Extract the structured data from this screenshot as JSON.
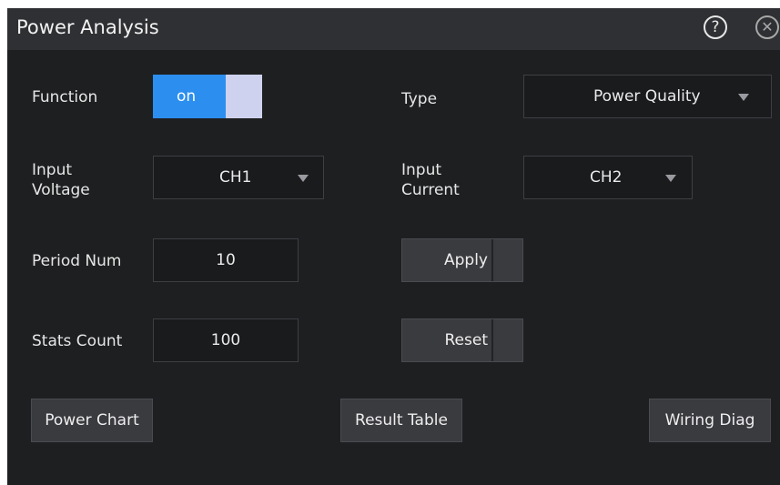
{
  "dialog": {
    "title": "Power Analysis",
    "help_icon": "help-icon",
    "close_icon": "close-icon"
  },
  "function": {
    "label": "Function",
    "toggle_state": "on"
  },
  "type": {
    "label": "Type",
    "value": "Power Quality"
  },
  "input_voltage": {
    "label": "Input Voltage",
    "value": "CH1"
  },
  "input_current": {
    "label": "Input Current",
    "value": "CH2"
  },
  "period_num": {
    "label": "Period Num",
    "value": "10"
  },
  "stats_count": {
    "label": "Stats Count",
    "value": "100"
  },
  "buttons": {
    "apply": "Apply",
    "reset": "Reset",
    "power_chart": "Power Chart",
    "result_table": "Result Table",
    "wiring_diag": "Wiring Diag"
  },
  "colors": {
    "toggle_on": "#2c8ff0",
    "toggle_knob": "#cfd2ee",
    "background": "#1e1f21",
    "titlebar": "#2f3033"
  }
}
